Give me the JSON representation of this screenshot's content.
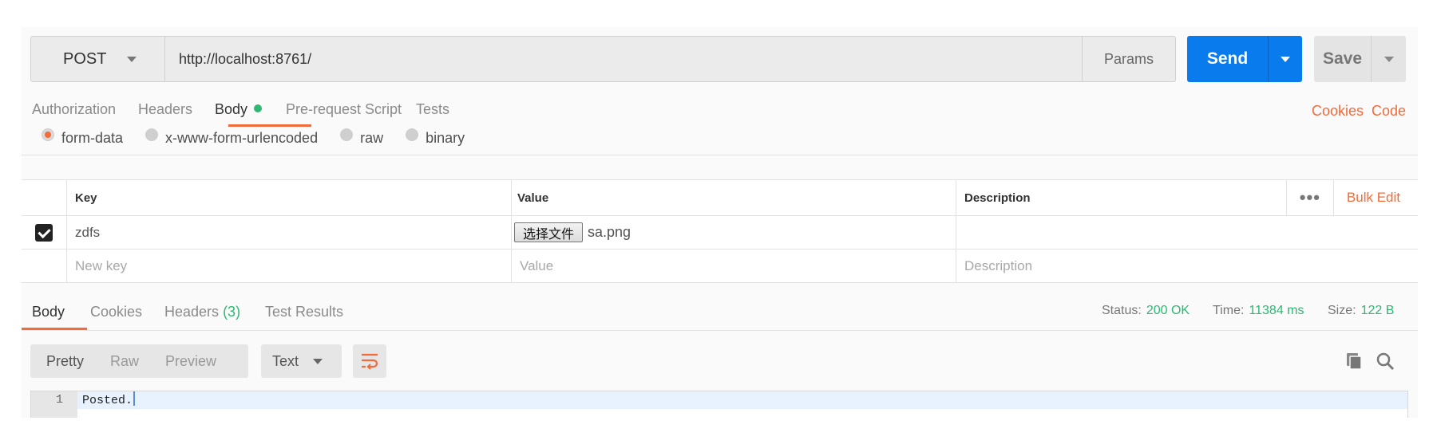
{
  "request": {
    "method": "POST",
    "url": "http://localhost:8761/",
    "params_label": "Params",
    "send_label": "Send",
    "save_label": "Save"
  },
  "request_tabs": {
    "authorization": "Authorization",
    "headers": "Headers",
    "body": "Body",
    "pre_request": "Pre-request Script",
    "tests": "Tests",
    "cookies": "Cookies",
    "code": "Code",
    "active": "Body"
  },
  "body_modes": {
    "form_data": "form-data",
    "urlencoded": "x-www-form-urlencoded",
    "raw": "raw",
    "binary": "binary",
    "selected": "form-data"
  },
  "kv_table": {
    "headers": {
      "key": "Key",
      "value": "Value",
      "description": "Description"
    },
    "more_icon": "ellipsis-icon",
    "bulk_edit": "Bulk Edit",
    "rows": [
      {
        "checked": true,
        "key": "zdfs",
        "file_button": "选择文件",
        "file_name": "sa.png",
        "description": ""
      }
    ],
    "placeholders": {
      "key": "New key",
      "value": "Value",
      "description": "Description"
    }
  },
  "response_tabs": {
    "body": "Body",
    "cookies": "Cookies",
    "headers": "Headers",
    "headers_count": "(3)",
    "test_results": "Test Results",
    "active": "Body"
  },
  "response_meta": {
    "status_label": "Status:",
    "status_value": "200 OK",
    "time_label": "Time:",
    "time_value": "11384 ms",
    "size_label": "Size:",
    "size_value": "122 B"
  },
  "response_toolbar": {
    "pretty": "Pretty",
    "raw": "Raw",
    "preview": "Preview",
    "format": "Text",
    "active": "Pretty"
  },
  "response_body": {
    "lines": [
      {
        "number": "1",
        "text": "Posted."
      }
    ]
  },
  "colors": {
    "accent": "#f26b3a",
    "send_blue": "#097bed",
    "success_green": "#2eb872"
  }
}
